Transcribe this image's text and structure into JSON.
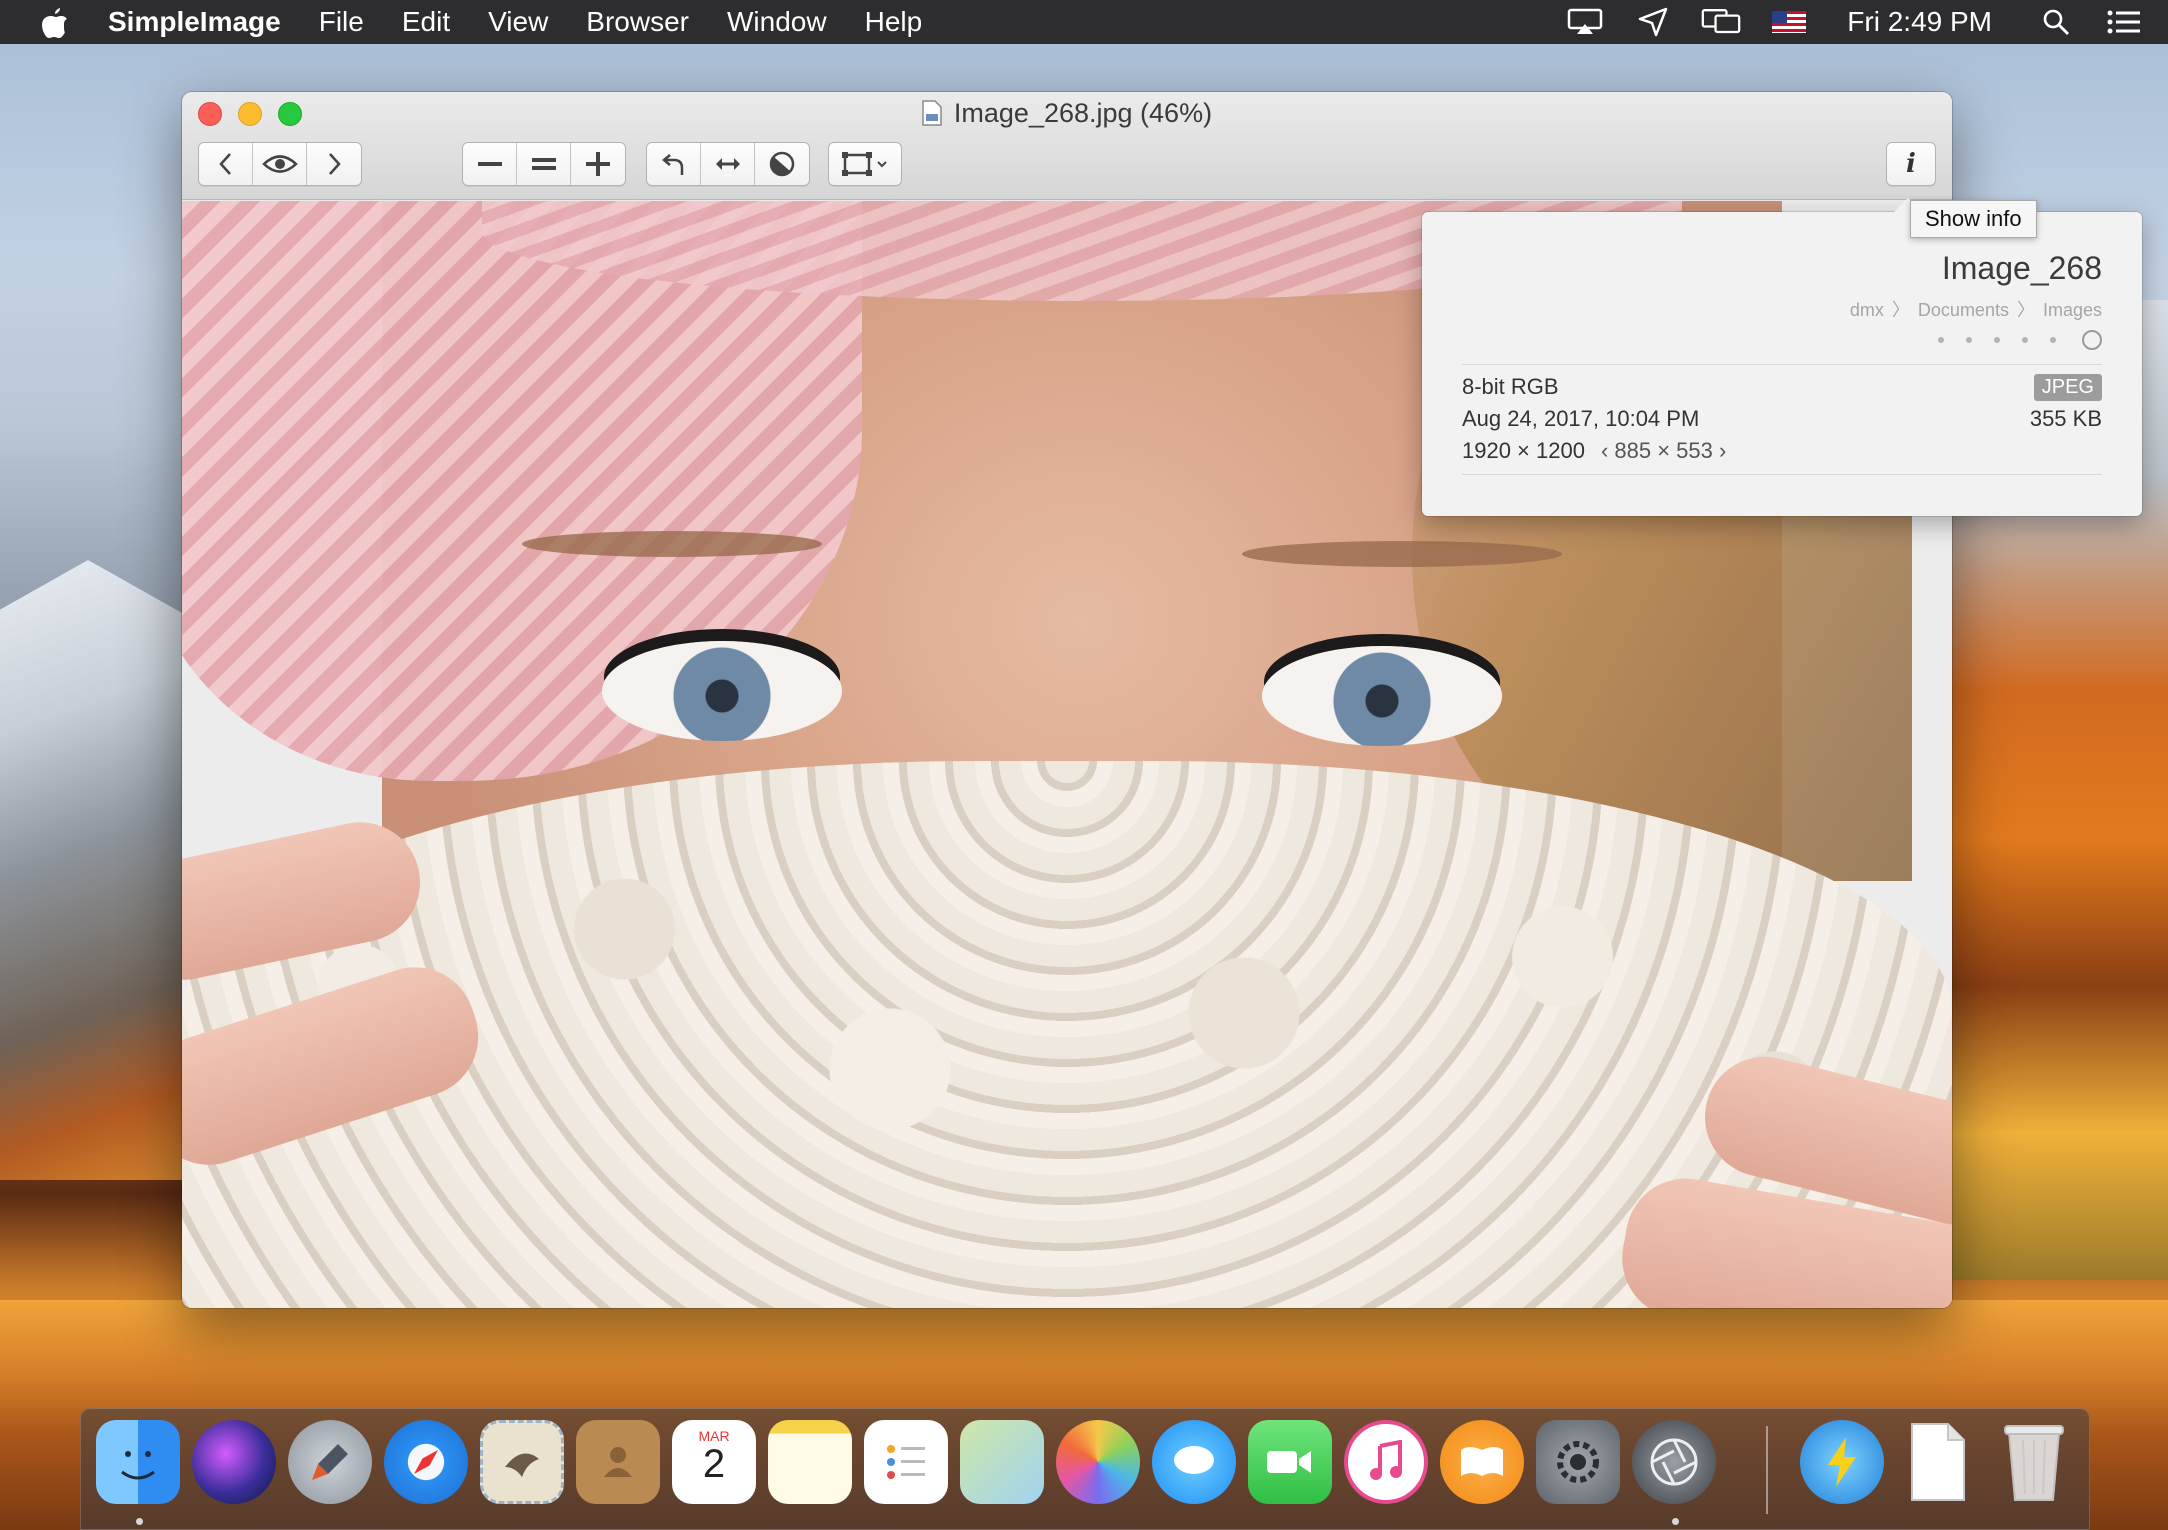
{
  "menubar": {
    "app_name": "SimpleImage",
    "menus": [
      "File",
      "Edit",
      "View",
      "Browser",
      "Window",
      "Help"
    ],
    "clock": "Fri 2:49 PM",
    "status_icons": [
      "airplay-icon",
      "location-icon",
      "display-mirror-icon",
      "us-flag-icon",
      "search-icon",
      "list-icon"
    ]
  },
  "window": {
    "title": "Image_268.jpg (46%)",
    "toolbar": {
      "nav": [
        "chevron-left-icon",
        "eye-icon",
        "chevron-right-icon"
      ],
      "zoom": [
        "zoom-out-icon",
        "actual-size-icon",
        "zoom-in-icon"
      ],
      "transform": [
        "rotate-icon",
        "flip-icon",
        "adjust-icon"
      ],
      "crop": "crop-icon",
      "info": "i"
    },
    "tooltip": "Show info"
  },
  "info": {
    "name": "Image_268",
    "path": [
      "dmx",
      "Documents",
      "Images"
    ],
    "color_mode": "8-bit RGB",
    "format": "JPEG",
    "date": "Aug 24, 2017, 10:04 PM",
    "size": "355 KB",
    "dimensions": "1920 × 1200",
    "scaled_dimensions": "‹ 885 × 553 ›",
    "rating": 0
  },
  "dock": {
    "apps": [
      "finder-icon",
      "siri-icon",
      "launchpad-icon",
      "safari-icon",
      "mail-icon",
      "contacts-icon",
      "calendar-icon",
      "notes-icon",
      "reminders-icon",
      "maps-icon",
      "photos-icon",
      "messages-icon",
      "facetime-icon",
      "itunes-icon",
      "ibooks-icon",
      "system-preferences-icon",
      "aperture-icon",
      "reeder-icon",
      "document-icon",
      "trash-icon"
    ],
    "calendar_month": "MAR",
    "calendar_day": "2"
  },
  "colors": {
    "menubar": "#2d2d2f",
    "close": "#fc5f57",
    "minimize": "#fdbc2e",
    "zoom": "#28c840",
    "badge": "#9c9c9c"
  }
}
